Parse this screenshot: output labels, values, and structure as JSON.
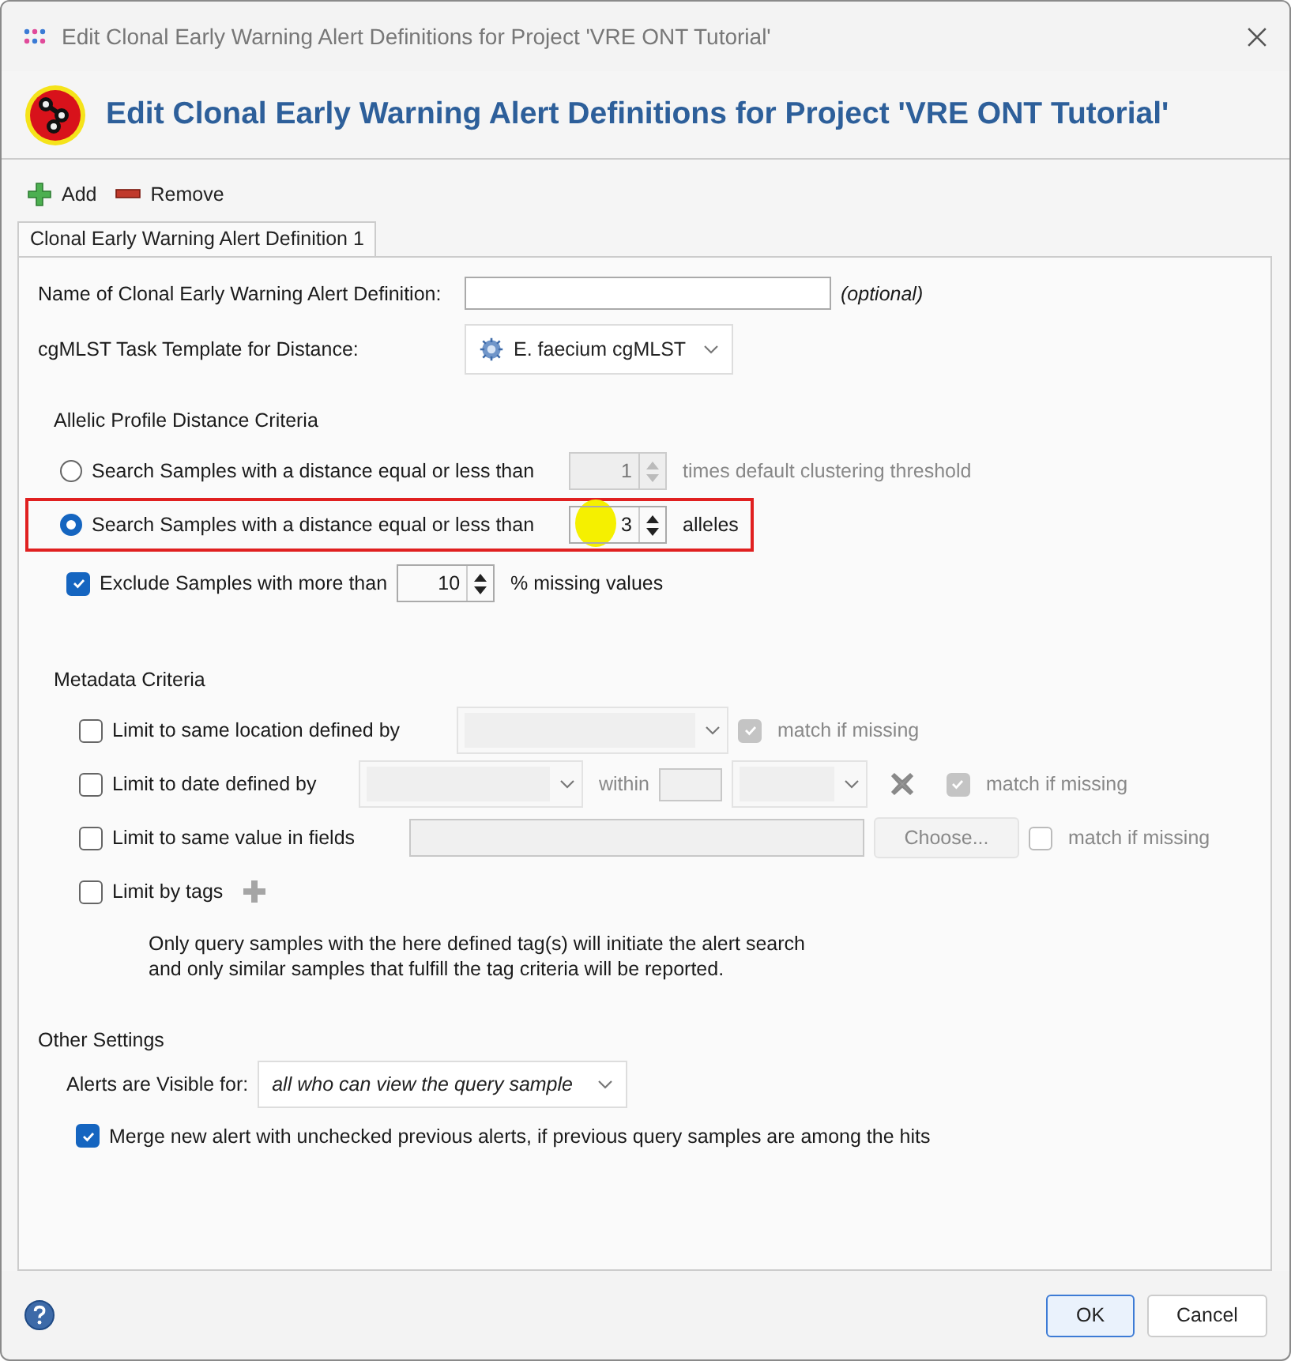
{
  "window": {
    "title": "Edit Clonal Early Warning Alert Definitions for Project 'VRE ONT Tutorial'"
  },
  "header": {
    "title": "Edit Clonal Early Warning Alert Definitions for Project 'VRE ONT Tutorial'"
  },
  "toolbar": [
    {
      "kind": "add",
      "label": "Add"
    },
    {
      "kind": "remove",
      "label": "Remove"
    }
  ],
  "tabs": [
    {
      "label": "Clonal Early Warning Alert Definition 1",
      "selected": true
    }
  ],
  "name_field": {
    "label": "Name of Clonal Early Warning Alert Definition:",
    "note": "(optional)"
  },
  "template": {
    "label": "cgMLST Task Template for Distance:",
    "value": "E. faecium cgMLST"
  },
  "distance_criteria": {
    "title": "Allelic Profile Distance Criteria",
    "options": [
      {
        "label": "Search Samples with a distance equal or less than",
        "value": "1",
        "unit": "times default clustering threshold",
        "selected": false,
        "disabled": true,
        "highlighted": false
      },
      {
        "label": "Search Samples with a distance equal or less than",
        "value": "3",
        "unit": "alleles",
        "selected": true,
        "disabled": false,
        "highlighted": true
      }
    ],
    "exclude": {
      "label": "Exclude Samples with more than",
      "value": "10",
      "unit": "% missing values",
      "checked": true
    }
  },
  "metadata": {
    "title": "Metadata Criteria",
    "rows": [
      {
        "kind": "location",
        "label": "Limit to same location defined by",
        "checked": false,
        "match": {
          "label": "match if missing",
          "checked": true,
          "disabled": true
        }
      },
      {
        "kind": "date",
        "label": "Limit to date defined by",
        "checked": false,
        "within": "within",
        "match": {
          "label": "match if missing",
          "checked": true,
          "disabled": true
        }
      },
      {
        "kind": "fields",
        "label": "Limit to same value in fields",
        "checked": false,
        "button": "Choose...",
        "match": {
          "label": "match if missing",
          "checked": false,
          "disabled": true
        }
      },
      {
        "kind": "tags",
        "label": "Limit by tags",
        "checked": false
      }
    ],
    "note": [
      "Only query samples with the here defined tag(s) will initiate the alert search",
      "and only similar samples that fulfill the tag criteria will be reported."
    ]
  },
  "other": {
    "title": "Other Settings",
    "visible_label": "Alerts are Visible for:",
    "visible_value": "all who can view the query sample",
    "merge": {
      "label": "Merge new alert with unchecked previous alerts, if previous query samples are among the hits",
      "checked": true
    }
  },
  "buttons": [
    {
      "label": "OK",
      "default": true
    },
    {
      "label": "Cancel",
      "default": false
    }
  ]
}
